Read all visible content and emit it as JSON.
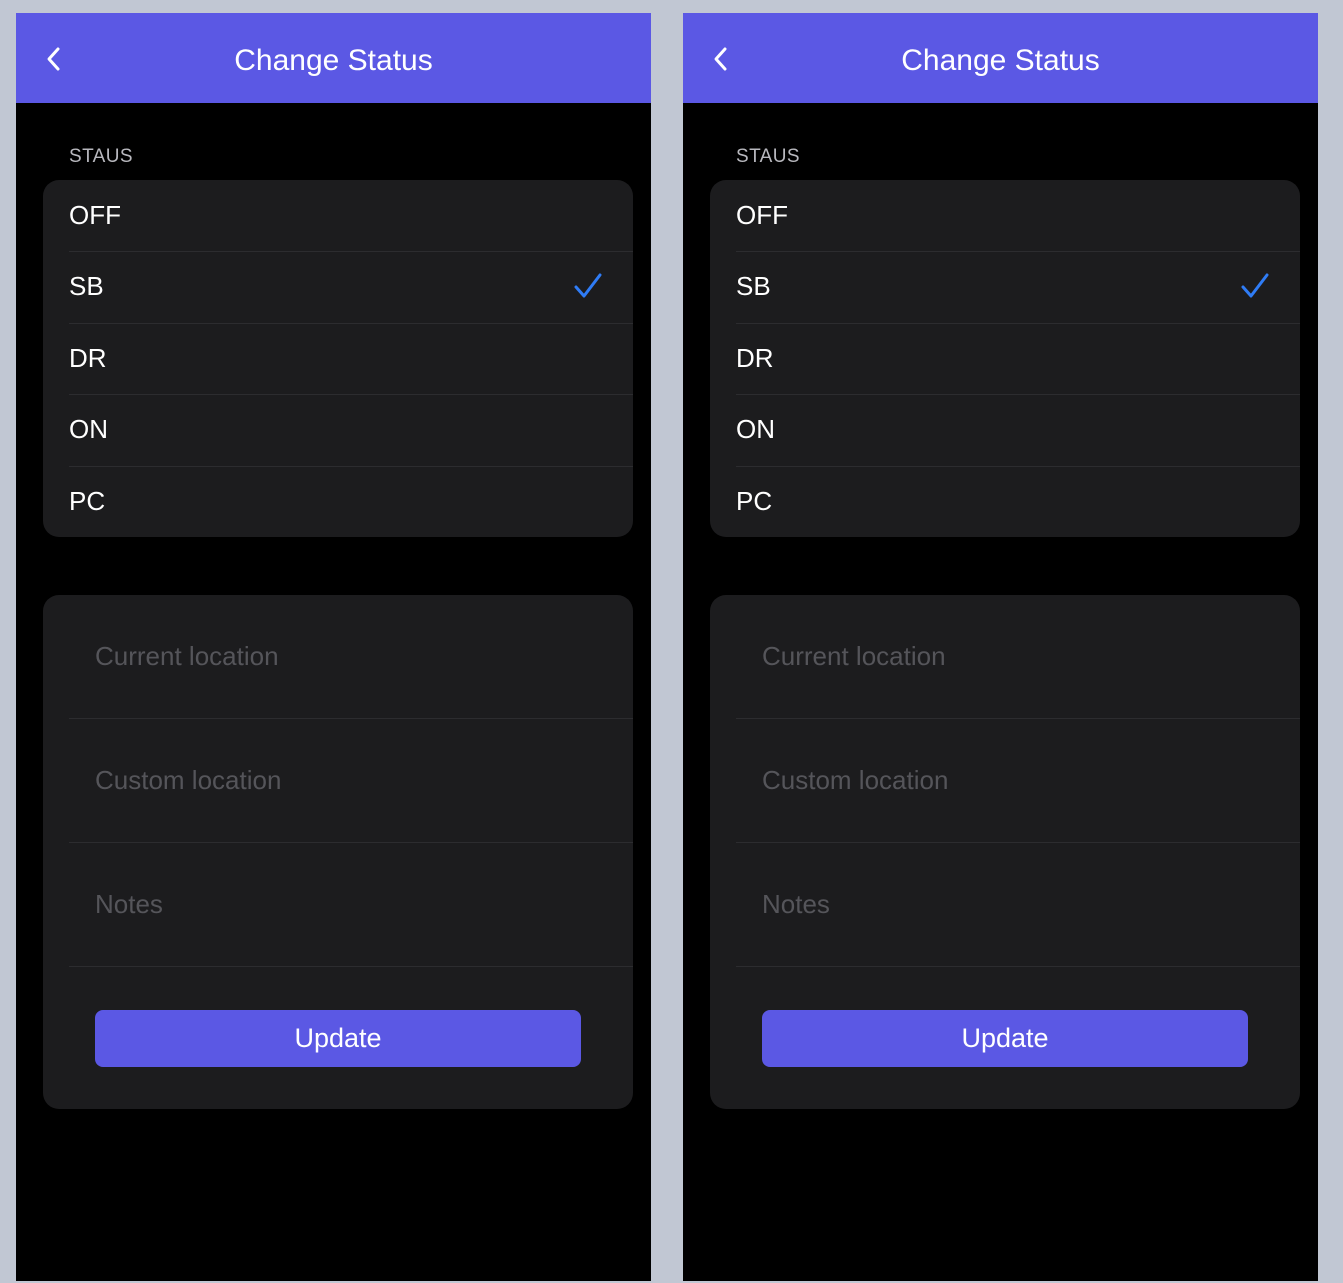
{
  "colors": {
    "accent": "#5b58e4",
    "checkmark": "#2f7cf6",
    "card_background": "#1c1c1e",
    "screen_background": "#000000",
    "outer_background": "#c1c7d3"
  },
  "icons": {
    "back": "chevron-left-icon",
    "selected": "checkmark-icon"
  },
  "screens": [
    {
      "nav": {
        "title": "Change Status"
      },
      "status_section": {
        "label": "STAUS",
        "selected": "SB",
        "options": [
          {
            "label": "OFF"
          },
          {
            "label": "SB"
          },
          {
            "label": "DR"
          },
          {
            "label": "ON"
          },
          {
            "label": "PC"
          }
        ]
      },
      "form": {
        "current_location": {
          "value": "",
          "placeholder": "Current location"
        },
        "custom_location": {
          "value": "",
          "placeholder": "Custom location"
        },
        "notes": {
          "value": "",
          "placeholder": "Notes"
        },
        "submit_label": "Update"
      }
    },
    {
      "nav": {
        "title": "Change Status"
      },
      "status_section": {
        "label": "STAUS",
        "selected": "SB",
        "options": [
          {
            "label": "OFF"
          },
          {
            "label": "SB"
          },
          {
            "label": "DR"
          },
          {
            "label": "ON"
          },
          {
            "label": "PC"
          }
        ]
      },
      "form": {
        "current_location": {
          "value": "",
          "placeholder": "Current location"
        },
        "custom_location": {
          "value": "",
          "placeholder": "Custom location"
        },
        "notes": {
          "value": "",
          "placeholder": "Notes"
        },
        "submit_label": "Update"
      }
    }
  ]
}
